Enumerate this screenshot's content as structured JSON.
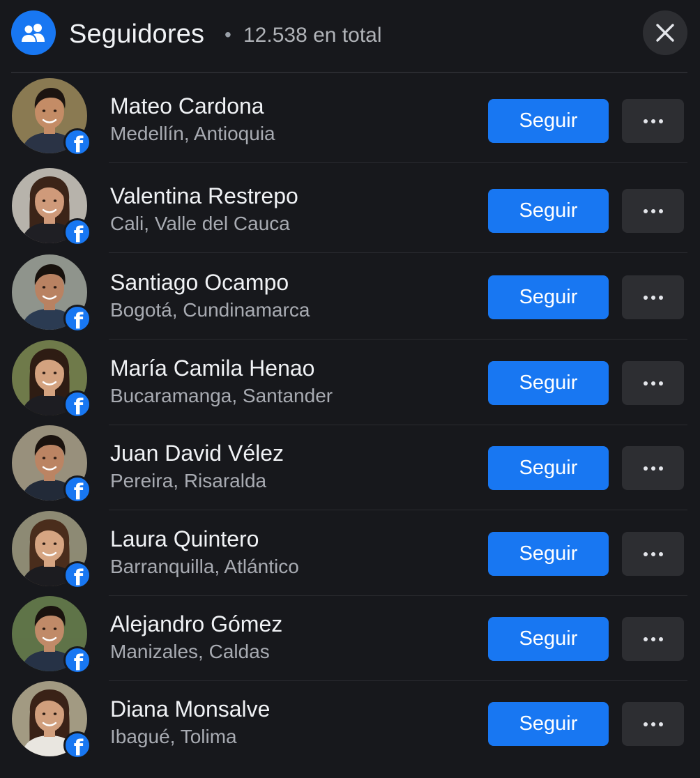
{
  "header": {
    "icon": "people-icon",
    "title": "Seguidores",
    "separator": "•",
    "count_text": "12.538 en total",
    "close_icon": "close-icon"
  },
  "colors": {
    "background": "#17181c",
    "accent": "#1877f2",
    "secondary_button": "#2d2e32",
    "name_text": "#f0f2f5",
    "location_text": "#a8abb2"
  },
  "actions": {
    "follow_label": "Seguir",
    "more_icon": "more-horizontal-icon",
    "badge_icon": "facebook-icon"
  },
  "followers": [
    {
      "name": "Mateo Cardona",
      "location": "Medellín, Antioquia",
      "gender": "m",
      "hair": "#1c1410",
      "skin": "#c48c66",
      "bg": "#8a7a52",
      "shirt": "#2a3345"
    },
    {
      "name": "Valentina Restrepo",
      "location": "Cali, Valle del Cauca",
      "gender": "f",
      "hair": "#3b2418",
      "skin": "#cf9a7a",
      "bg": "#b7b3ab",
      "shirt": "#1f1f24"
    },
    {
      "name": "Santiago Ocampo",
      "location": "Bogotá, Cundinamarca",
      "gender": "m",
      "hair": "#17110d",
      "skin": "#b98262",
      "bg": "#8f948c",
      "shirt": "#2b3b52"
    },
    {
      "name": "María Camila Henao",
      "location": "Bucaramanga, Santander",
      "gender": "f",
      "hair": "#2e1c13",
      "skin": "#d3a27f",
      "bg": "#6f7a4a",
      "shirt": "#1d1d22"
    },
    {
      "name": "Juan David Vélez",
      "location": "Pereira, Risaralda",
      "gender": "m",
      "hair": "#1a120e",
      "skin": "#bb8463",
      "bg": "#98907c",
      "shirt": "#222a38"
    },
    {
      "name": "Laura Quintero",
      "location": "Barranquilla, Atlántico",
      "gender": "f",
      "hair": "#4a2d1c",
      "skin": "#d6a582",
      "bg": "#8d8a74",
      "shirt": "#1c1c20"
    },
    {
      "name": "Alejandro Gómez",
      "location": "Manizales, Caldas",
      "gender": "m",
      "hair": "#19120e",
      "skin": "#c08a68",
      "bg": "#5f7448",
      "shirt": "#263246"
    },
    {
      "name": "Diana Monsalve",
      "location": "Ibagué, Tolima",
      "gender": "f",
      "hair": "#3a2217",
      "skin": "#d19f7d",
      "bg": "#a29a82",
      "shirt": "#e9e6e0"
    }
  ]
}
